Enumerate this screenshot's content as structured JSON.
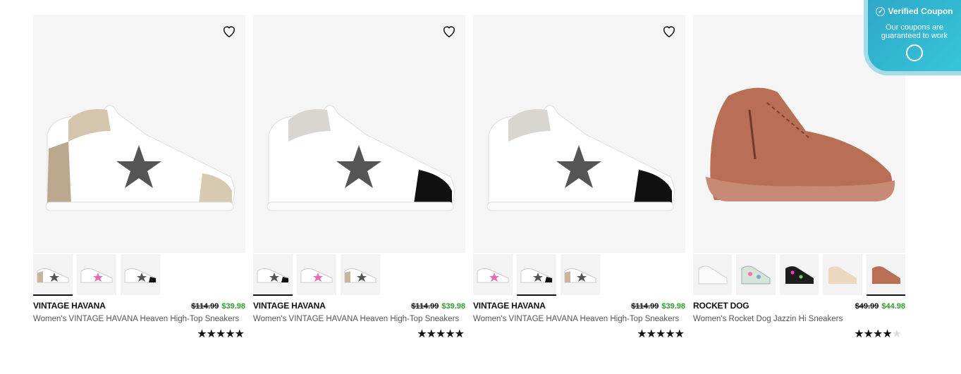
{
  "coupon": {
    "title": "Verified Coupon",
    "text": "Our coupons are guaranteed to work"
  },
  "colors": {
    "sale_price": "#2e9b2a",
    "card_bg": "#f5f5f5",
    "coupon_bg": "#36c6d8"
  },
  "products": [
    {
      "brand": "VINTAGE HAVANA",
      "old_price": "$114.99",
      "new_price": "$39.98",
      "title": "Women's VINTAGE HAVANA Heaven High-Top Sneakers",
      "rating": 5,
      "thumb_count": 3,
      "active_thumb": 0
    },
    {
      "brand": "VINTAGE HAVANA",
      "old_price": "$114.99",
      "new_price": "$39.98",
      "title": "Women's VINTAGE HAVANA Heaven High-Top Sneakers",
      "rating": 5,
      "thumb_count": 3,
      "active_thumb": 0
    },
    {
      "brand": "VINTAGE HAVANA",
      "old_price": "$114.99",
      "new_price": "$39.98",
      "title": "Women's VINTAGE HAVANA Heaven High-Top Sneakers",
      "rating": 5,
      "thumb_count": 3,
      "active_thumb": 1
    },
    {
      "brand": "ROCKET DOG",
      "old_price": "$49.99",
      "new_price": "$44.98",
      "title": "Women's Rocket Dog Jazzin Hi Sneakers",
      "rating": 4,
      "thumb_count": 5,
      "active_thumb": 4
    }
  ]
}
